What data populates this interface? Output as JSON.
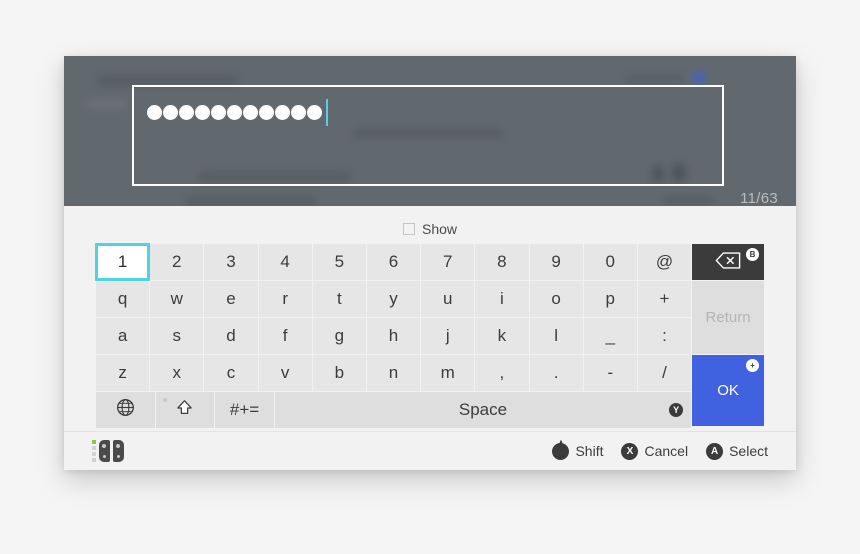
{
  "window": {
    "char_counter": "11/63",
    "password_dot_count": 11,
    "caret_color": "#4ed4e0"
  },
  "show_option": {
    "label": "Show",
    "checked": false,
    "icon": "checkbox-icon"
  },
  "keyboard": {
    "selected_key": "1",
    "selection_color": "#4ed4e0",
    "rows": [
      {
        "keys": [
          "1",
          "2",
          "3",
          "4",
          "5",
          "6",
          "7",
          "8",
          "9",
          "0",
          "@"
        ]
      },
      {
        "keys": [
          "q",
          "w",
          "e",
          "r",
          "t",
          "y",
          "u",
          "i",
          "o",
          "p",
          "+"
        ]
      },
      {
        "keys": [
          "a",
          "s",
          "d",
          "f",
          "g",
          "h",
          "j",
          "k",
          "l",
          "_",
          ":"
        ]
      },
      {
        "keys": [
          "z",
          "x",
          "c",
          "v",
          "b",
          "n",
          "m",
          ",",
          ".",
          "-",
          "/"
        ]
      }
    ],
    "function_row": {
      "globe": "globe-icon",
      "shift": "shift-icon",
      "symbols_label": "#+=",
      "space_label": "Space",
      "space_badge": "Y"
    },
    "side_keys": {
      "backspace_badge": "B",
      "backspace_icon": "backspace-icon",
      "return_label": "Return",
      "ok_label": "OK",
      "ok_badge": "+",
      "ok_color": "#4061e0"
    }
  },
  "status_bar": {
    "controller": "joycon-pair-icon",
    "hints": [
      {
        "glyph": "stick",
        "label": "Shift"
      },
      {
        "glyph": "X",
        "label": "Cancel"
      },
      {
        "glyph": "A",
        "label": "Select"
      }
    ]
  }
}
